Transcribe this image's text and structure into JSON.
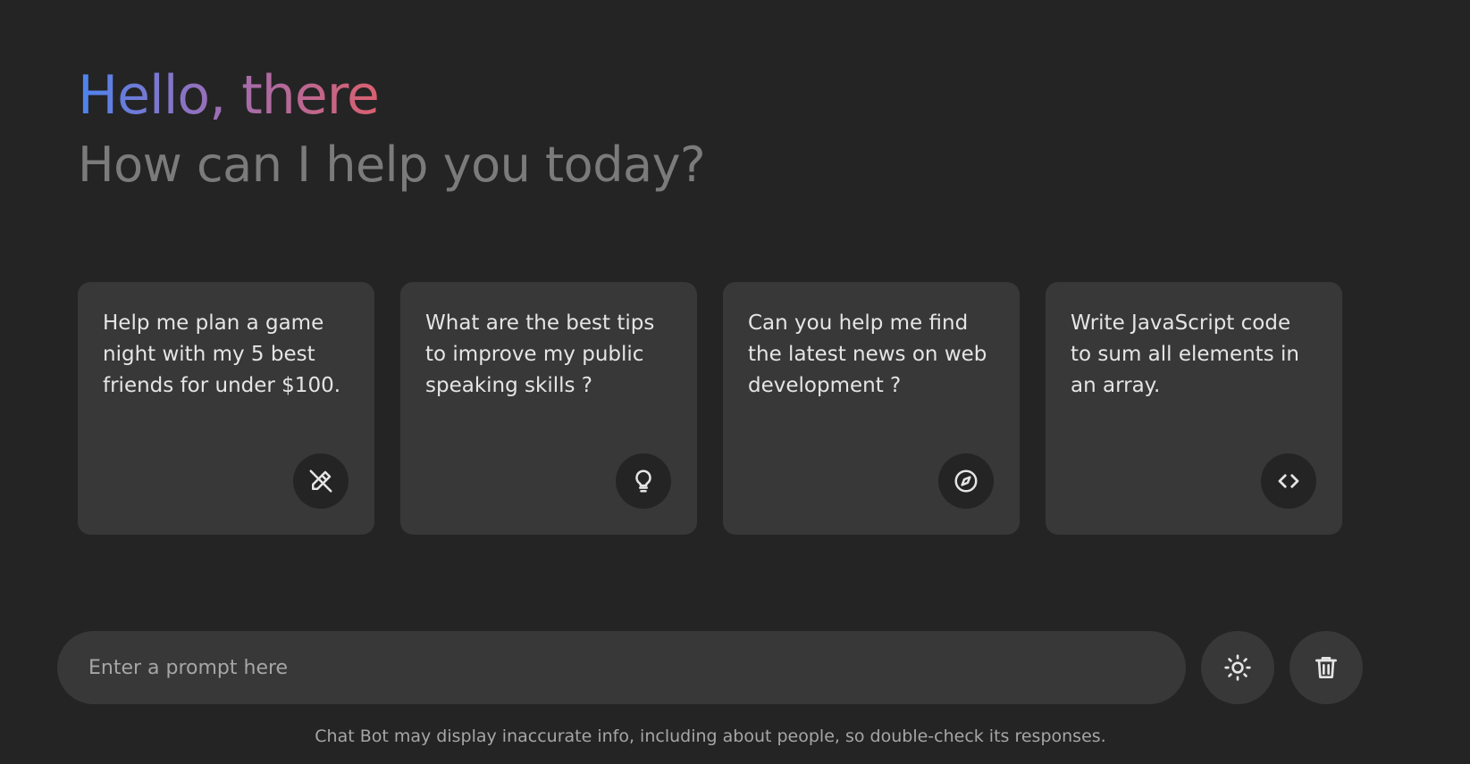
{
  "header": {
    "title": "Hello, there",
    "subtitle": "How can I help you today?"
  },
  "suggestions": [
    {
      "text": "Help me plan a game night with my 5 best friends for under $100.",
      "icon": "draw-icon"
    },
    {
      "text": "What are the best tips to improve my public speaking skills ?",
      "icon": "lightbulb-icon"
    },
    {
      "text": "Can you help me find the latest news on web development ?",
      "icon": "compass-icon"
    },
    {
      "text": "Write JavaScript code to sum all elements in an array.",
      "icon": "code-icon"
    }
  ],
  "input": {
    "placeholder": "Enter a prompt here",
    "value": ""
  },
  "buttons": {
    "theme_icon": "sun-icon",
    "delete_icon": "trash-icon"
  },
  "disclaimer": "Chat Bot may display inaccurate info, including about people, so double-check its responses.",
  "colors": {
    "background": "#242424",
    "card": "#383838",
    "gradient_start": "#4c84f0",
    "gradient_end": "#d9606f",
    "subtitle": "#7b7b7b"
  }
}
